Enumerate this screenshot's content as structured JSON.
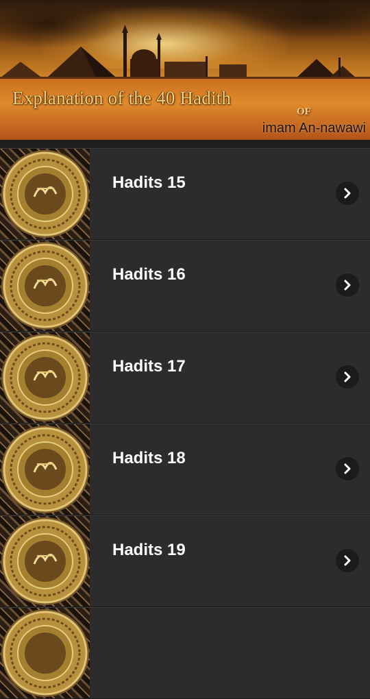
{
  "banner": {
    "title": "Explanation of the 40 Hadith",
    "of_text": "OF",
    "subtitle": "imam An-nawawi"
  },
  "list": {
    "items": [
      {
        "label": "Hadits 15",
        "thumb_icon": "gold-medallion-icon"
      },
      {
        "label": "Hadits 16",
        "thumb_icon": "gold-medallion-icon"
      },
      {
        "label": "Hadits 17",
        "thumb_icon": "gold-medallion-icon"
      },
      {
        "label": "Hadits 18",
        "thumb_icon": "gold-medallion-icon"
      },
      {
        "label": "Hadits 19",
        "thumb_icon": "gold-medallion-icon"
      },
      {
        "label": "",
        "thumb_icon": "gold-medallion-icon"
      }
    ],
    "chevron_icon": "chevron-right-icon"
  },
  "colors": {
    "list_background": "#2c2c2c",
    "label": "#ffffff",
    "chevron_bg": "#1b1b1b",
    "gold": "#c9a24a"
  }
}
